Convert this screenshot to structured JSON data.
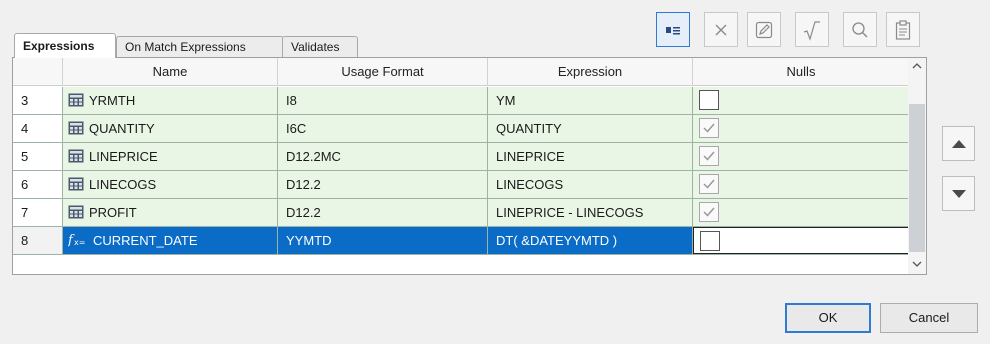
{
  "tabs": [
    "Expressions",
    "On Match Expressions",
    "Validates"
  ],
  "toolbar": {
    "buttons": [
      {
        "icon": "view-toggle-icon",
        "active": true
      },
      {
        "icon": "delete-icon",
        "active": false
      },
      {
        "icon": "edit-icon",
        "active": false
      },
      {
        "icon": "sqrt-icon",
        "active": false
      },
      {
        "icon": "search-icon",
        "active": false
      },
      {
        "icon": "clipboard-icon",
        "active": false
      }
    ]
  },
  "grid": {
    "columns": [
      "",
      "Name",
      "Usage Format",
      "Expression",
      "Nulls"
    ],
    "rows": [
      {
        "num": "3",
        "name": "YRMTH",
        "format": "I8",
        "expression": "YM",
        "icon": "field-icon",
        "nulls_checked": false,
        "nulls_enabled": true,
        "selected": false
      },
      {
        "num": "4",
        "name": "QUANTITY",
        "format": "I6C",
        "expression": "QUANTITY",
        "icon": "field-icon",
        "nulls_checked": true,
        "nulls_enabled": false,
        "selected": false
      },
      {
        "num": "5",
        "name": "LINEPRICE",
        "format": "D12.2MC",
        "expression": "LINEPRICE",
        "icon": "field-icon",
        "nulls_checked": true,
        "nulls_enabled": false,
        "selected": false
      },
      {
        "num": "6",
        "name": "LINECOGS",
        "format": "D12.2",
        "expression": "LINECOGS",
        "icon": "field-icon",
        "nulls_checked": true,
        "nulls_enabled": false,
        "selected": false
      },
      {
        "num": "7",
        "name": "PROFIT",
        "format": "D12.2",
        "expression": "LINEPRICE - LINECOGS",
        "icon": "field-icon",
        "nulls_checked": true,
        "nulls_enabled": false,
        "selected": false
      },
      {
        "num": "8",
        "name": "CURRENT_DATE",
        "format": "YYMTD",
        "expression": "DT( &DATEYYMTD )",
        "icon": "function-icon",
        "nulls_checked": false,
        "nulls_enabled": true,
        "selected": true
      }
    ]
  },
  "buttons": {
    "ok": "OK",
    "cancel": "Cancel"
  },
  "colors": {
    "selection": "#0a6cc6",
    "row_fill": "#eaf6e5",
    "accent": "#2f7bd4"
  }
}
